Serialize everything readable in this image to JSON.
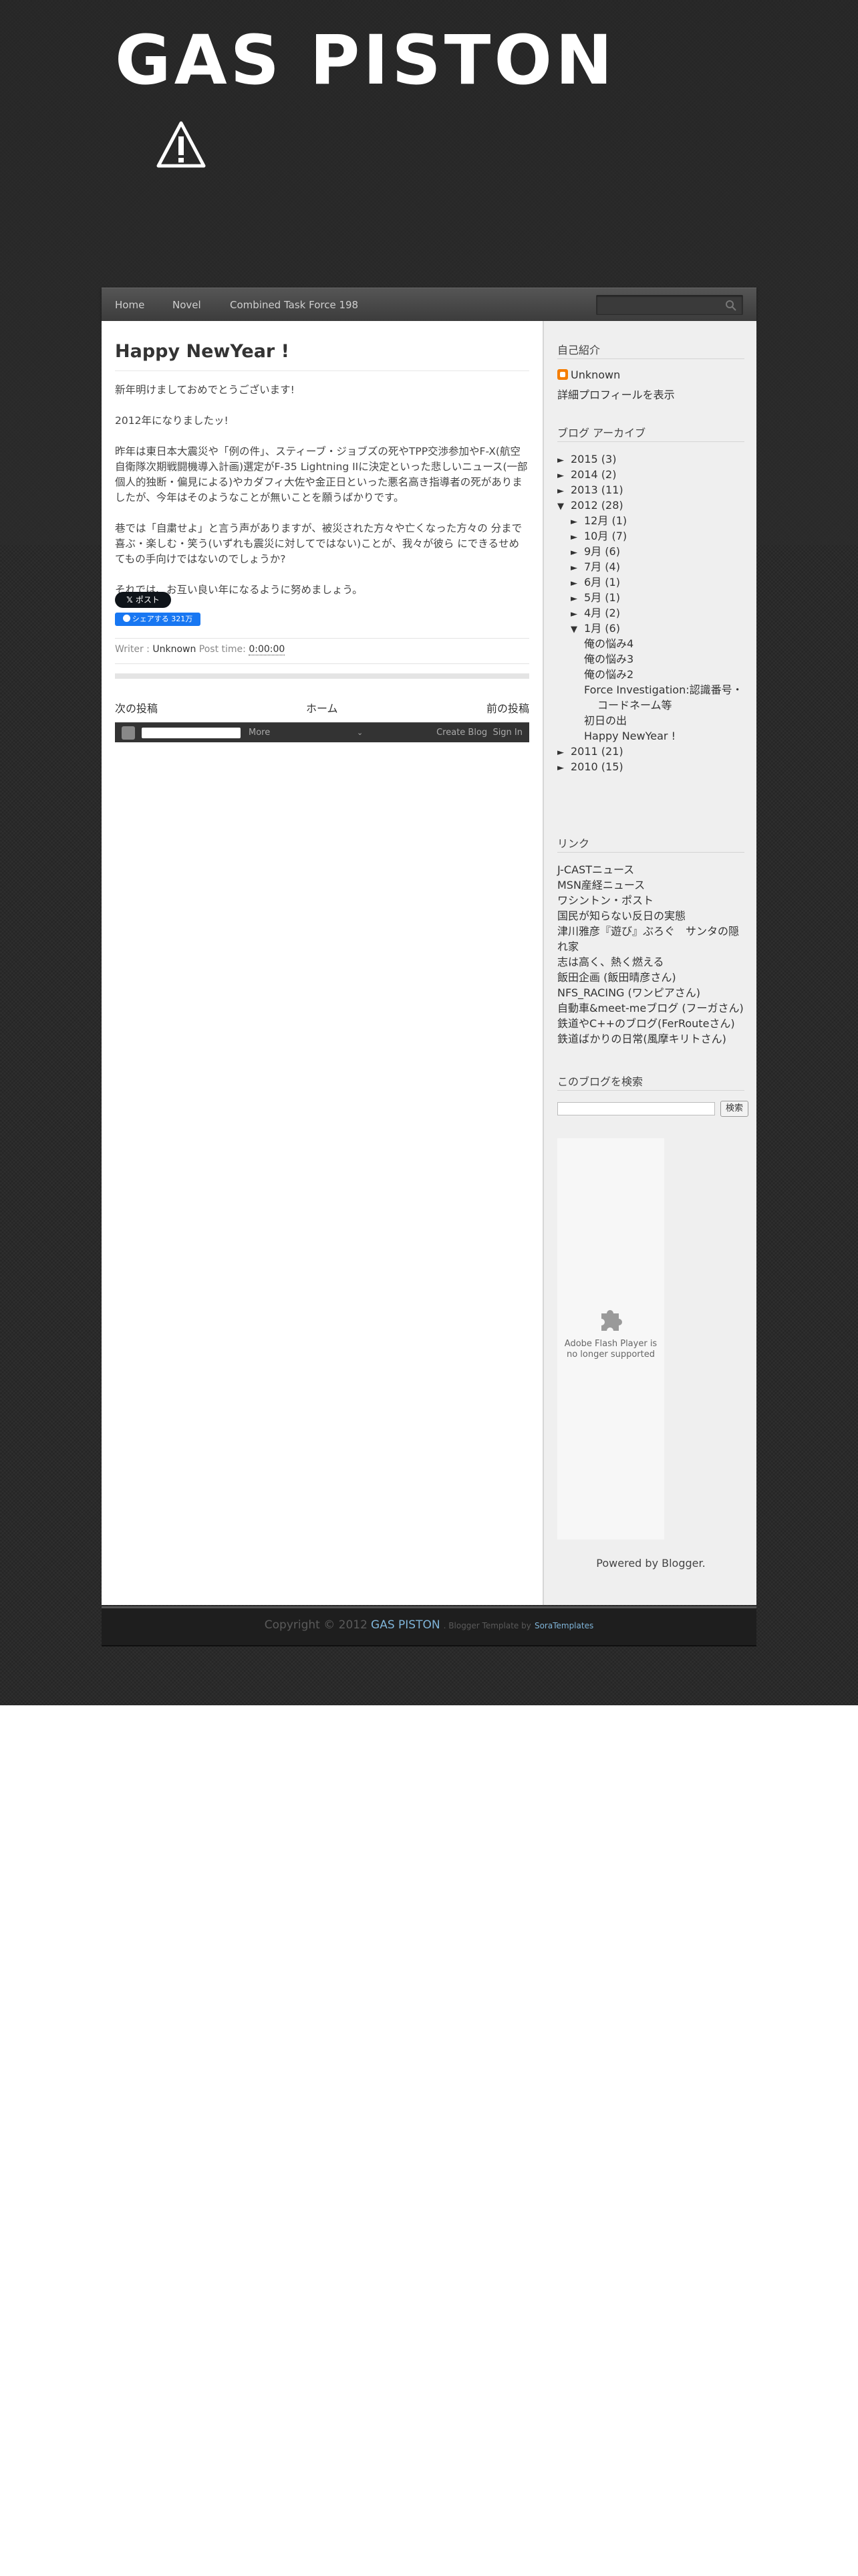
{
  "header": {
    "site_title": "GAS PISTON",
    "warning_icon": "warning-triangle-icon"
  },
  "nav": {
    "items": [
      "Home",
      "Novel",
      "Combined Task Force 198"
    ],
    "search_icon": "search-icon"
  },
  "post": {
    "title": "Happy NewYear !",
    "paragraphs": [
      "新年明けましておめでとうございます!",
      "2012年になりましたッ!",
      "昨年は東日本大震災や「例の件」、スティーブ・ジョブズの死やTPP交渉参加やF-X(航空自衛隊次期戦闘機導入計画)選定がF-35 Lightning IIに決定といった悲しいニュース(一部個人的独断・偏見による)やカダフィ大佐や金正日といった悪名高き指導者の死がありましたが、今年はそのようなことが無いことを願うばかりです。",
      "巷では「自粛せよ」と言う声がありますが、被災された方々や亡くなった方々の 分まで喜ぶ・楽しむ・笑う(いずれも震災に対してではない)ことが、我々が彼ら にできるせめてもの手向けではないのでしょうか?",
      "それでは、お互い良い年になるように努めましょう。"
    ],
    "x_button": "ポスト",
    "fb_button": "シェアする 321万",
    "writer_label": "Writer :",
    "writer": "Unknown",
    "time_label": "Post time:",
    "time": "0:00:00"
  },
  "pager": {
    "newer": "次の投稿",
    "home": "ホーム",
    "older": "前の投稿"
  },
  "blogger_bar": {
    "more": "More",
    "create_blog": "Create Blog",
    "sign_in": "Sign In"
  },
  "sidebar": {
    "profile_heading": "自己紹介",
    "profile_name": "Unknown",
    "profile_link": "詳細プロフィールを表示",
    "archive_heading": "ブログ アーカイブ",
    "archive": [
      {
        "tri": "►",
        "text": "2015 (3)"
      },
      {
        "tri": "►",
        "text": "2014 (2)"
      },
      {
        "tri": "►",
        "text": "2013 (11)"
      },
      {
        "tri": "▼",
        "text": "2012 (28)"
      },
      {
        "tri": "►",
        "text": "12月 (1)"
      },
      {
        "tri": "►",
        "text": "10月 (7)"
      },
      {
        "tri": "►",
        "text": "9月 (6)"
      },
      {
        "tri": "►",
        "text": "7月 (4)"
      },
      {
        "tri": "►",
        "text": "6月 (1)"
      },
      {
        "tri": "►",
        "text": "5月 (1)"
      },
      {
        "tri": "►",
        "text": "4月 (2)"
      },
      {
        "tri": "▼",
        "text": "1月 (6)"
      },
      {
        "tri": "",
        "text": "俺の悩み4"
      },
      {
        "tri": "",
        "text": "俺の悩み3"
      },
      {
        "tri": "",
        "text": "俺の悩み2"
      },
      {
        "tri": "",
        "text": "Force Investigation:認識番号・"
      },
      {
        "tri": "",
        "text": "コードネーム等"
      },
      {
        "tri": "",
        "text": "初日の出"
      },
      {
        "tri": "",
        "text": "Happy NewYear !"
      },
      {
        "tri": "►",
        "text": "2011 (21)"
      },
      {
        "tri": "►",
        "text": "2010 (15)"
      }
    ],
    "links_heading": "リンク",
    "links": [
      "J-CASTニュース",
      "MSN産経ニュース",
      "ワシントン・ポスト",
      "国民が知らない反日の実態",
      "津川雅彦『遊び』ぶろぐ　サンタの隠",
      "れ家",
      "志は高く、熱く燃える",
      "飯田企画 (飯田晴彦さん)",
      "NFS_RACING (ワンピアさん)",
      "自動車&meet-meブログ (フーガさん)",
      "鉄道やC++のブログ(FerRouteさん)",
      "鉄道ばかりの日常(風摩キリトさん)"
    ],
    "search_heading": "このブログを検索",
    "search_button": "検索",
    "flash_text": "Adobe Flash Player is no longer supported",
    "powered": "Powered by Blogger."
  },
  "footer": {
    "copyright": "Copyright © 2012",
    "site": "GAS PISTON",
    "template_by": ". Blogger Template by",
    "sora": "SoraTemplates"
  }
}
